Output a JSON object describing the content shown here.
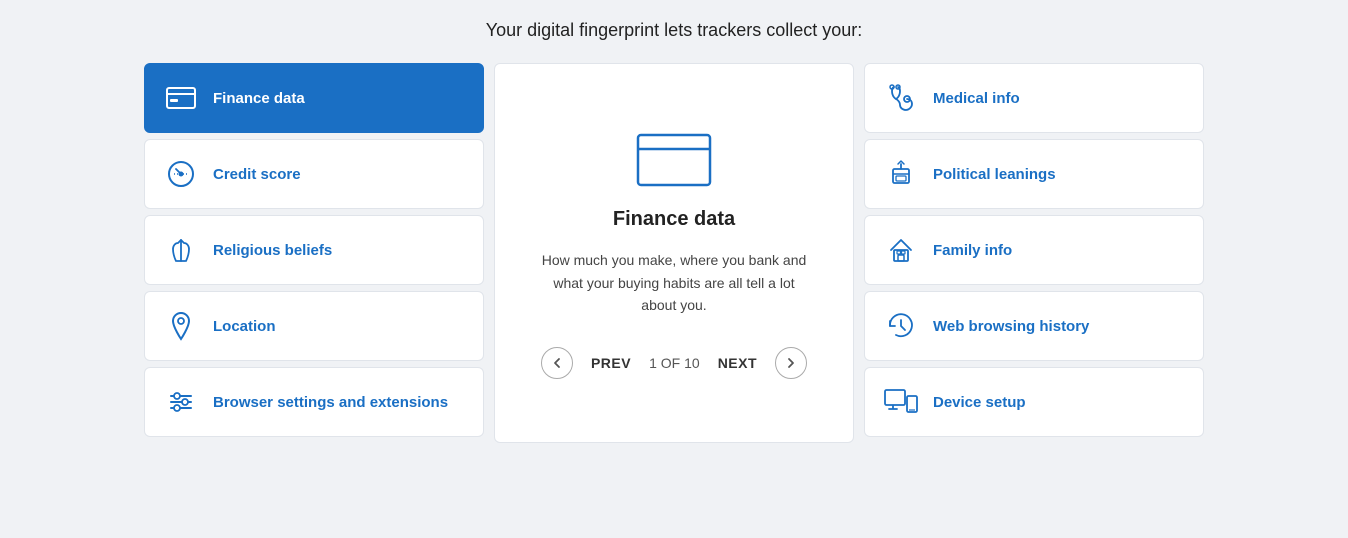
{
  "header": {
    "subtitle": "Your digital fingerprint lets trackers collect your:"
  },
  "left_col": {
    "items": [
      {
        "id": "finance-data",
        "label": "Finance data",
        "active": true,
        "icon": "credit-card"
      },
      {
        "id": "credit-score",
        "label": "Credit score",
        "active": false,
        "icon": "gauge"
      },
      {
        "id": "religious-beliefs",
        "label": "Religious beliefs",
        "active": false,
        "icon": "hands"
      },
      {
        "id": "location",
        "label": "Location",
        "active": false,
        "icon": "pin"
      },
      {
        "id": "browser-settings",
        "label": "Browser settings and extensions",
        "active": false,
        "icon": "sliders"
      }
    ]
  },
  "center": {
    "title": "Finance data",
    "description": "How much you make, where you bank and what your buying habits are all tell a lot about you.",
    "nav": {
      "prev_label": "PREV",
      "next_label": "NEXT",
      "count": "1 OF 10"
    }
  },
  "right_col": {
    "items": [
      {
        "id": "medical-info",
        "label": "Medical info",
        "icon": "stethoscope"
      },
      {
        "id": "political-leanings",
        "label": "Political leanings",
        "icon": "podium"
      },
      {
        "id": "family-info",
        "label": "Family info",
        "icon": "house"
      },
      {
        "id": "web-browsing-history",
        "label": "Web browsing history",
        "icon": "history"
      },
      {
        "id": "device-setup",
        "label": "Device setup",
        "icon": "devices"
      }
    ]
  }
}
